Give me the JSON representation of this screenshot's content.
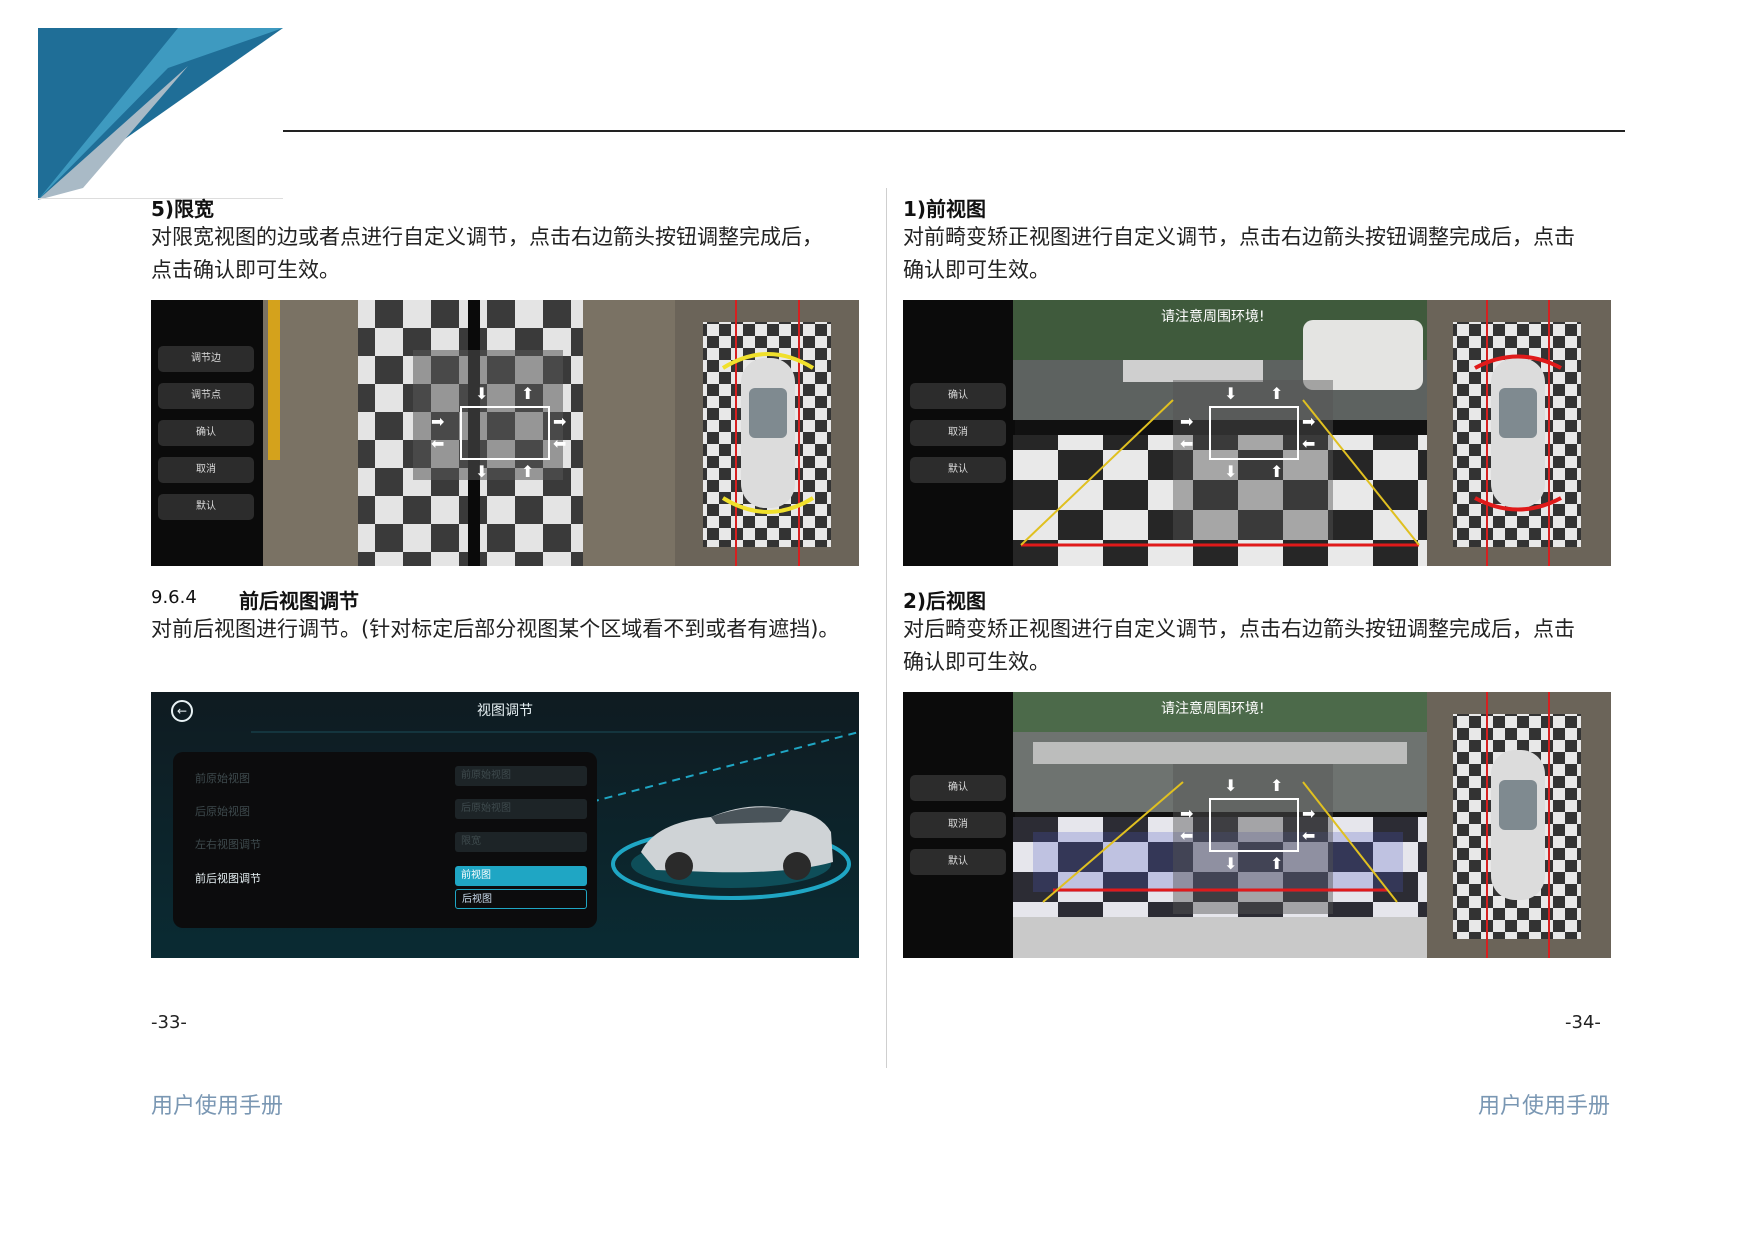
{
  "left": {
    "section_heading": "5)限宽",
    "section_text_1": "对限宽视图的边或者点进行自定义调节，点击右边箭头按钮调整完成后，",
    "section_text_2": "点击确认即可生效。",
    "fig1_buttons": [
      "调节边",
      "调节点",
      "确认",
      "取消",
      "默认"
    ],
    "subsection_number": "9.6.4",
    "subsection_title": "前后视图调节",
    "subsection_text": "对前后视图进行调节。(针对标定后部分视图某个区域看不到或者有遮挡)。",
    "view_adjust_ui": {
      "title": "视图调节",
      "rows": [
        {
          "label": "前原始视图",
          "value": "前原始视图"
        },
        {
          "label": "后原始视图",
          "value": "后原始视图"
        },
        {
          "label": "左右视图调节",
          "value": "限宽"
        },
        {
          "label": "前后视图调节",
          "value": "前视图"
        }
      ],
      "extra_option": "后视图"
    },
    "page_number": "-33-",
    "footer": "用户使用手册"
  },
  "right": {
    "front_heading": "1)前视图",
    "front_text_1": "对前畸变矫正视图进行自定义调节，点击右边箭头按钮调整完成后，点击",
    "front_text_2": "确认即可生效。",
    "front_warning": "请注意周围环境!",
    "rear_heading": "2)后视图",
    "rear_text_1": "对后畸变矫正视图进行自定义调节，点击右边箭头按钮调整完成后，点击",
    "rear_text_2": "确认即可生效。",
    "rear_warning": "请注意周围环境!",
    "camera_buttons": [
      "确认",
      "取消",
      "默认"
    ],
    "page_number": "-34-",
    "footer": "用户使用手册"
  },
  "colors": {
    "logo_dark_blue": "#1f6e97",
    "logo_blue": "#3e9ac0",
    "logo_grey": "#a9bac6",
    "footer_text": "#7a97b3",
    "ui_accent": "#1fa6c4"
  }
}
